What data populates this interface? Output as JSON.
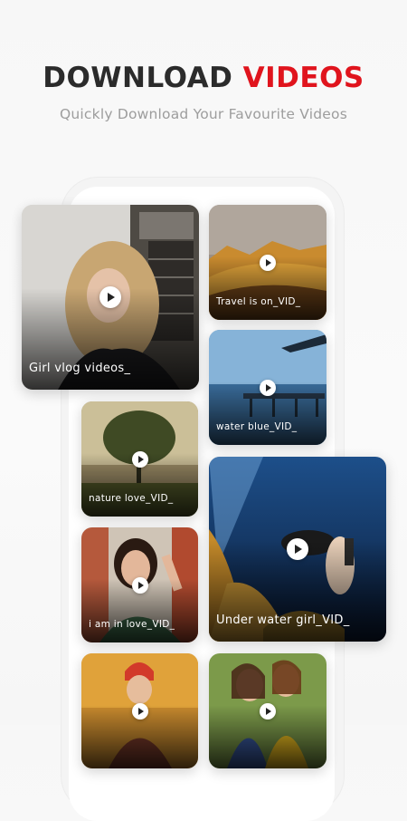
{
  "header": {
    "title_part1": "DOWNLOAD",
    "title_part2": "VIDEOS",
    "subtitle": "Quickly Download Your Favourite Videos"
  },
  "colors": {
    "accent": "#e0141d",
    "title": "#2b2b2b",
    "subtitle": "#9d9d9d"
  },
  "videos": [
    {
      "title": "Girl vlog videos_",
      "icon": "play-icon"
    },
    {
      "title": "Travel is on_VID_",
      "icon": "play-icon"
    },
    {
      "title": "water blue_VID_",
      "icon": "play-icon"
    },
    {
      "title": "nature love_VID_",
      "icon": "play-icon"
    },
    {
      "title": "Under water girl_VID_",
      "icon": "play-icon"
    },
    {
      "title": "i am in love_VID_",
      "icon": "play-icon"
    },
    {
      "title": "",
      "icon": "play-icon"
    },
    {
      "title": "",
      "icon": "play-icon"
    }
  ]
}
